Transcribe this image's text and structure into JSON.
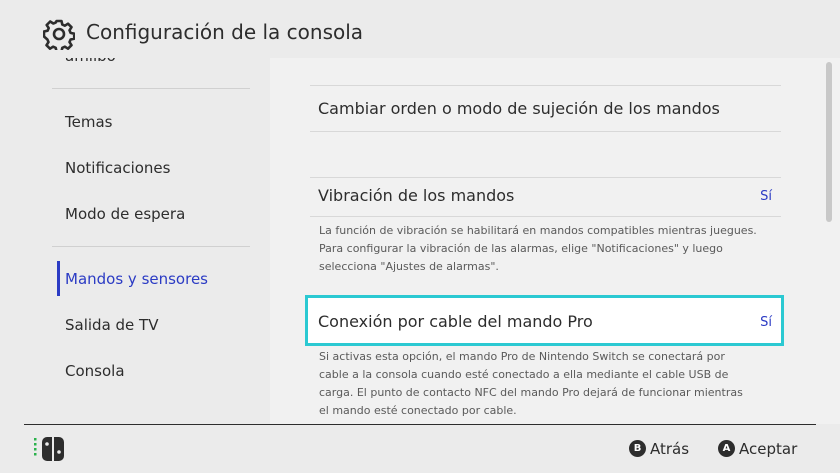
{
  "header": {
    "title": "Configuración de la consola",
    "icon": "gear-icon"
  },
  "sidebar": {
    "partial_item": "amiibo",
    "items": [
      {
        "label": "Temas"
      },
      {
        "label": "Notificaciones"
      },
      {
        "label": "Modo de espera"
      },
      {
        "label": "Mandos y sensores"
      },
      {
        "label": "Salida de TV"
      },
      {
        "label": "Consola"
      }
    ],
    "active_index": 3
  },
  "main": {
    "rows": [
      {
        "label": "Cambiar orden o modo de sujeción de los mandos"
      },
      {
        "label": "Vibración de los mandos",
        "value": "Sí",
        "description": [
          "La función de vibración se habilitará en mandos compatibles mientras juegues.",
          "Para configurar la vibración de las alarmas, elige \"Notificaciones\" y luego",
          "selecciona \"Ajustes de alarmas\"."
        ]
      },
      {
        "label": "Conexión por cable del mando Pro",
        "value": "Sí",
        "selected": true,
        "description": [
          "Si activas esta opción, el mando Pro de Nintendo Switch se conectará por",
          "cable a la consola cuando esté conectado a ella mediante el cable USB de",
          "carga. El punto de contacto NFC del mando Pro dejará de funcionar mientras",
          "el mando esté conectado por cable."
        ]
      }
    ]
  },
  "footer": {
    "back": {
      "key": "B",
      "label": "Atrás"
    },
    "accept": {
      "key": "A",
      "label": "Aceptar"
    }
  },
  "colors": {
    "background": "#ebebeb",
    "panel": "#f1f1f1",
    "accent_blue": "#2b3bc4",
    "selection_cyan": "#2bc9d2",
    "text": "#2d2d2d"
  }
}
